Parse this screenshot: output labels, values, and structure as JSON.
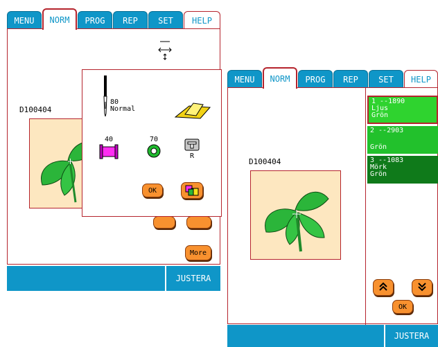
{
  "tabs": [
    "MENU",
    "NORM",
    "PROG",
    "REP",
    "SET",
    "HELP"
  ],
  "active_tab": "NORM",
  "left": {
    "design_name": "D100404",
    "needle": {
      "size": "80",
      "type": "Normal"
    },
    "threads": {
      "bobbin_weight": "40",
      "spool_weight": "70",
      "presser_foot": "R"
    },
    "ok_label": "OK",
    "more_label": "More",
    "justera_label": "JUSTERA"
  },
  "right": {
    "design_name": "D100404",
    "thread_list": [
      {
        "line1": "1 --1890",
        "line2": "Ljus",
        "line3": "Grön",
        "color": "#2fd32f",
        "selected": true
      },
      {
        "line1": "2 --2903",
        "line2": "",
        "line3": "Grön",
        "color": "#22c12c",
        "selected": false
      },
      {
        "line1": "3 --1083",
        "line2": "Mörk",
        "line3": "Grön",
        "color": "#0f7a1a",
        "selected": false
      }
    ],
    "ok_label": "OK",
    "justera_label": "JUSTERA"
  },
  "colors": {
    "tab_blue": "#0f96c8",
    "frame_red": "#b5232c",
    "button_orange": "#f8912f",
    "preview_bg": "#fde7c0"
  }
}
